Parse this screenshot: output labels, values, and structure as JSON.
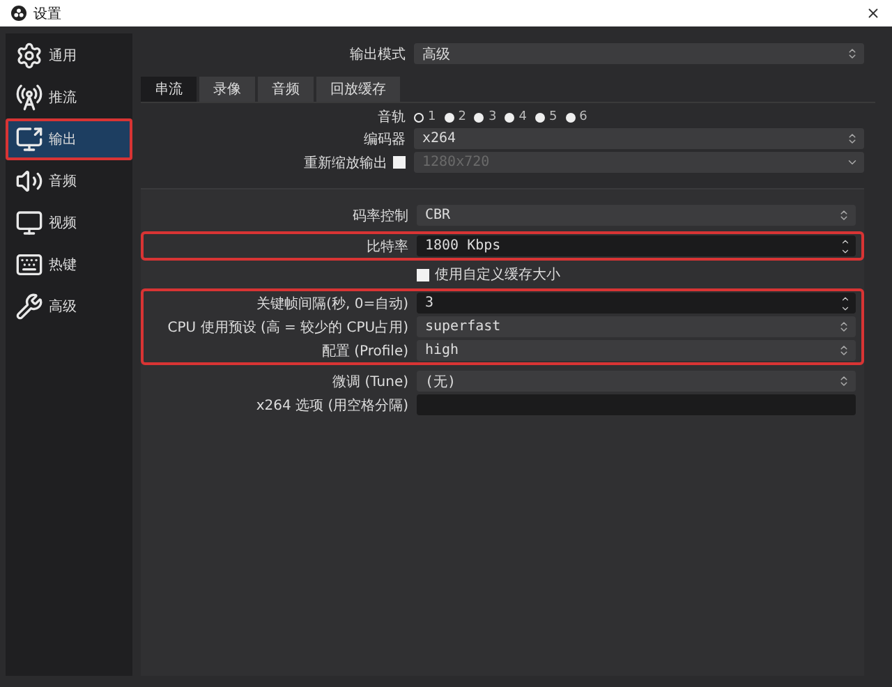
{
  "window": {
    "title": "设置"
  },
  "sidebar": {
    "items": [
      {
        "label": "通用",
        "selected": false
      },
      {
        "label": "推流",
        "selected": false
      },
      {
        "label": "输出",
        "selected": true,
        "highlighted": true
      },
      {
        "label": "音频",
        "selected": false
      },
      {
        "label": "视频",
        "selected": false
      },
      {
        "label": "热键",
        "selected": false
      },
      {
        "label": "高级",
        "selected": false
      }
    ]
  },
  "output_mode": {
    "label": "输出模式",
    "value": "高级"
  },
  "tabs": [
    {
      "label": "串流",
      "selected": true
    },
    {
      "label": "录像",
      "selected": false
    },
    {
      "label": "音频",
      "selected": false
    },
    {
      "label": "回放缓存",
      "selected": false
    }
  ],
  "audio_track": {
    "label": "音轨",
    "options": [
      {
        "label": "1",
        "selected": true
      },
      {
        "label": "2",
        "selected": false
      },
      {
        "label": "3",
        "selected": false
      },
      {
        "label": "4",
        "selected": false
      },
      {
        "label": "5",
        "selected": false
      },
      {
        "label": "6",
        "selected": false
      }
    ]
  },
  "encoder": {
    "label": "编码器",
    "value": "x264"
  },
  "rescale": {
    "label": "重新缩放输出",
    "checked": false,
    "value": "1280x720",
    "disabled": true
  },
  "encoder_settings": [
    {
      "highlighted": false,
      "rows": [
        {
          "kind": "select",
          "label": "码率控制",
          "value": "CBR"
        }
      ]
    },
    {
      "highlighted": true,
      "rows": [
        {
          "kind": "spin",
          "label": "比特率",
          "value": "1800 Kbps"
        }
      ]
    },
    {
      "highlighted": false,
      "rows": [
        {
          "kind": "checkbox",
          "label": "使用自定义缓存大小",
          "checked": false
        }
      ]
    },
    {
      "highlighted": true,
      "rows": [
        {
          "kind": "spin",
          "label": "关键帧间隔(秒, 0=自动)",
          "value": "3"
        },
        {
          "kind": "select",
          "label": "CPU 使用预设 (高 = 较少的 CPU占用)",
          "value": "superfast"
        },
        {
          "kind": "select",
          "label": "配置 (Profile)",
          "value": "high"
        }
      ]
    },
    {
      "highlighted": false,
      "rows": [
        {
          "kind": "select",
          "label": "微调 (Tune)",
          "value": "(无)"
        },
        {
          "kind": "text",
          "label": "x264 选项 (用空格分隔)",
          "value": ""
        }
      ]
    }
  ]
}
